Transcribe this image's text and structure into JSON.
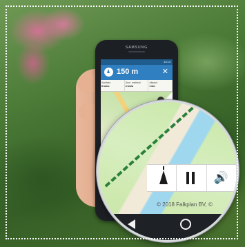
{
  "phone": {
    "brand": "SAMSUNG",
    "status_time": "13:14"
  },
  "navigation": {
    "distance": "150 m",
    "close_glyph": "✕"
  },
  "stats": [
    {
      "label": "Snelheid",
      "value": "6 km/u"
    },
    {
      "label": "Gem. snelheid",
      "value": "4 km/u"
    },
    {
      "label": "Afstand",
      "value": "1 km"
    }
  ],
  "controls": {
    "navigate_icon": "navigation-arrow-icon",
    "pause_icon": "pause-icon",
    "sound_glyph": "🔊"
  },
  "map": {
    "copyright": "© 2018 Falkplan BV, ©"
  },
  "colors": {
    "header_blue": "#2f7fc1",
    "route_green": "#2b7f3a",
    "water": "#9fd7ef"
  }
}
